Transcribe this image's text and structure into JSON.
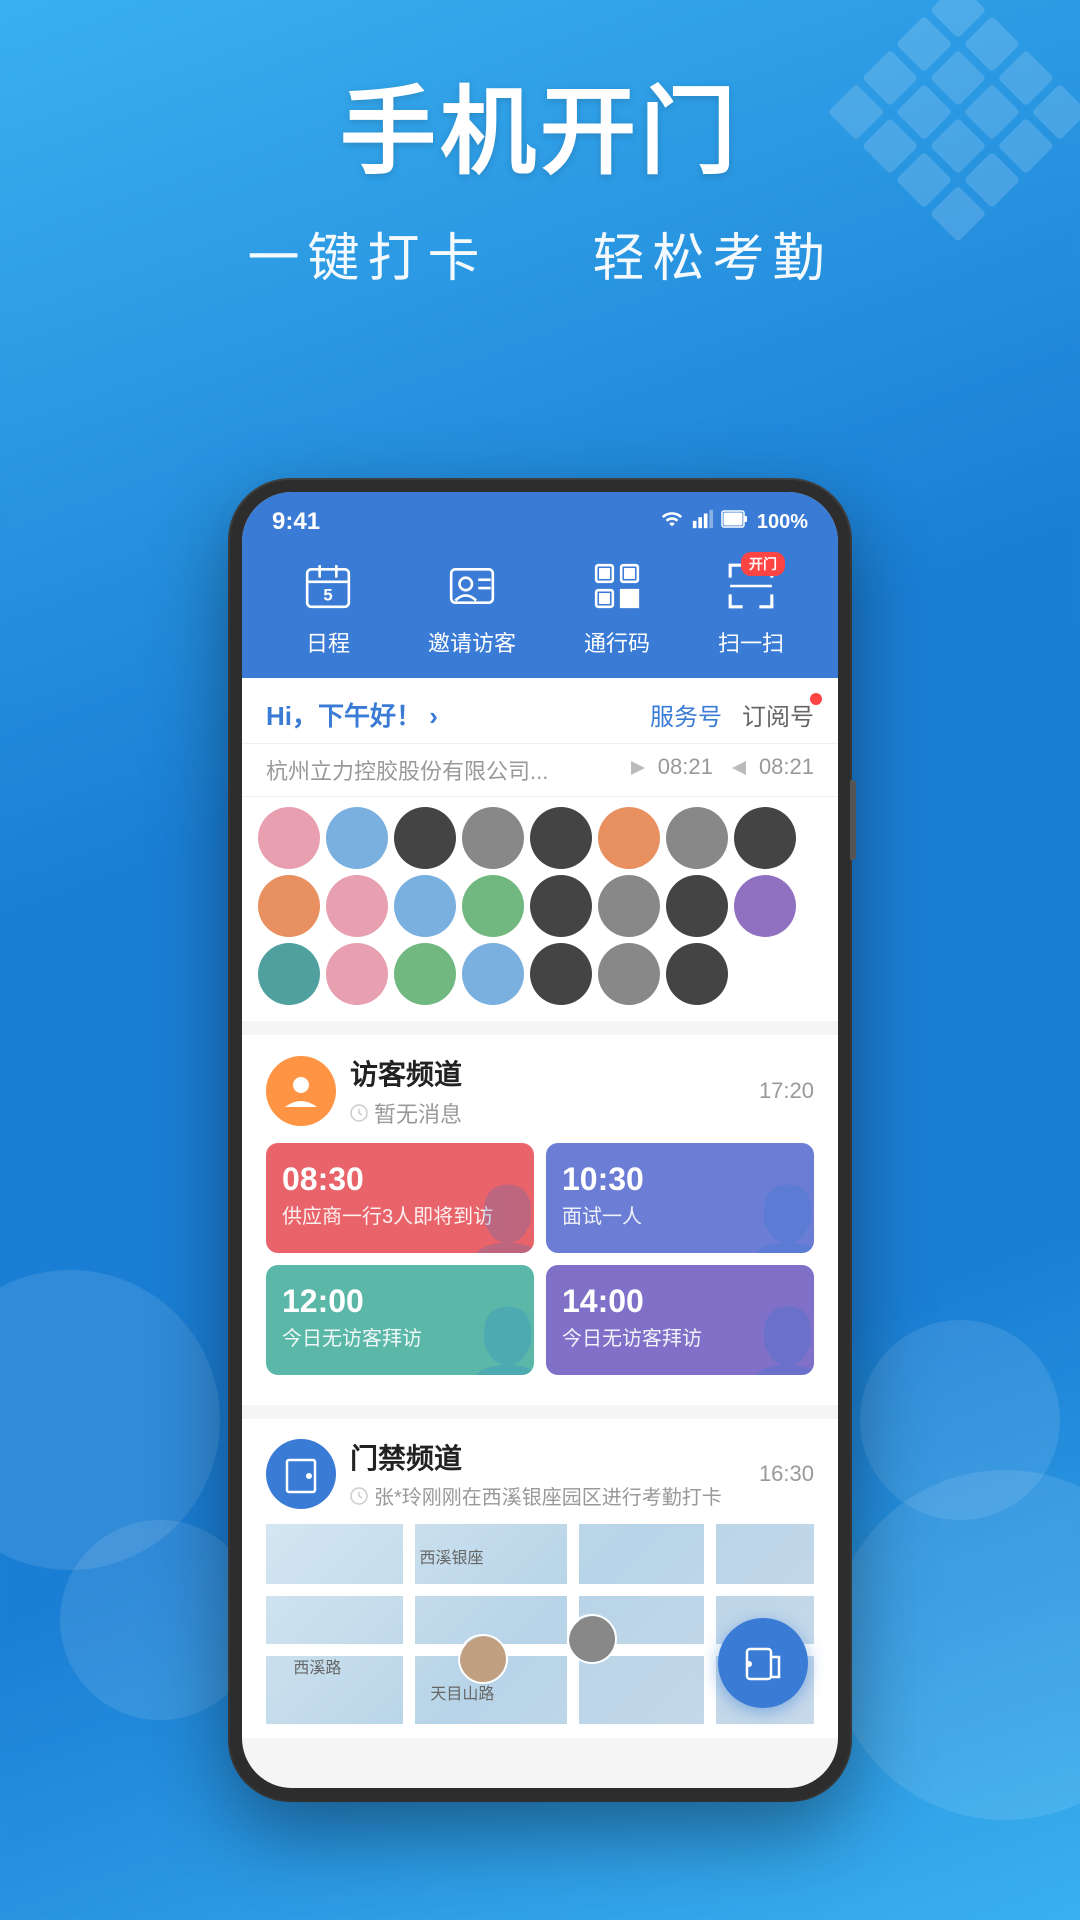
{
  "background": {
    "gradient_start": "#3ab0f0",
    "gradient_end": "#1a7ed4"
  },
  "hero": {
    "main_title": "手机开门",
    "sub_title_part1": "一键打卡",
    "sub_title_part2": "轻松考勤"
  },
  "phone": {
    "status_bar": {
      "time": "9:41",
      "wifi": "wifi",
      "signal": "signal",
      "battery": "100%"
    },
    "nav_items": [
      {
        "id": "schedule",
        "label": "日程",
        "icon": "calendar"
      },
      {
        "id": "invite",
        "label": "邀请访客",
        "icon": "person-card"
      },
      {
        "id": "pass",
        "label": "通行码",
        "icon": "qr-code"
      },
      {
        "id": "scan",
        "label": "扫一扫",
        "icon": "scan",
        "badge": "开门"
      }
    ],
    "greeting": {
      "text": "Hi，下午好！ ›",
      "tab_service": "服务号",
      "tab_subscribe": "订阅号"
    },
    "message_preview": {
      "text": "杭州立力控胶股份有限公司...",
      "time1": "08:21",
      "time2": "08:21"
    },
    "channels": [
      {
        "id": "visitor",
        "name": "访客频道",
        "sub": "暂无消息",
        "time": "17:20",
        "type": "visitor",
        "events": [
          {
            "time": "08:30",
            "desc": "供应商一行3人即将到访",
            "color": "red"
          },
          {
            "time": "10:30",
            "desc": "面试一人",
            "color": "blue"
          },
          {
            "time": "12:00",
            "desc": "今日无访客拜访",
            "color": "teal"
          },
          {
            "time": "14:00",
            "desc": "今日无访客拜访",
            "color": "purple"
          }
        ]
      },
      {
        "id": "door",
        "name": "门禁频道",
        "sub": "张*玲刚刚在西溪银座园区进行考勤打卡",
        "time": "16:30",
        "type": "door"
      }
    ],
    "fab": {
      "label": "open-door"
    }
  }
}
